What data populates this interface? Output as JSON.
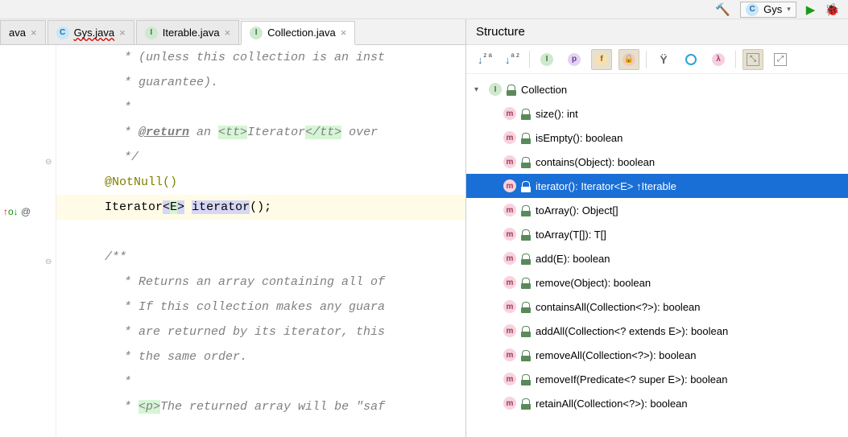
{
  "toolbar": {
    "run_config": "Gys"
  },
  "tabs": [
    {
      "label": "ava",
      "kind": "none",
      "wavy": false,
      "active": false,
      "close": true
    },
    {
      "label": "Gys.java",
      "kind": "c",
      "wavy": true,
      "active": false,
      "close": true
    },
    {
      "label": "Iterable.java",
      "kind": "i",
      "wavy": false,
      "active": false,
      "close": true
    },
    {
      "label": "Collection.java",
      "kind": "i",
      "wavy": false,
      "active": true,
      "close": true
    }
  ],
  "gutter": {
    "marker": "↑o↓ @"
  },
  "editor": {
    "lines": [
      {
        "cls": "l0",
        "parts": [
          {
            "t": " * (unless this collection is an inst",
            "c": "comment"
          }
        ]
      },
      {
        "cls": "l0",
        "parts": [
          {
            "t": " * guarantee).",
            "c": "comment"
          }
        ]
      },
      {
        "cls": "l0",
        "parts": [
          {
            "t": " *",
            "c": "comment"
          }
        ]
      },
      {
        "cls": "l0",
        "parts": [
          {
            "t": " * ",
            "c": "comment"
          },
          {
            "t": "@return",
            "c": "jdtag"
          },
          {
            "t": " an ",
            "c": "comment"
          },
          {
            "t": "<tt>",
            "c": "comment hl-green"
          },
          {
            "t": "Iterator",
            "c": "comment"
          },
          {
            "t": "</tt>",
            "c": "comment hl-green"
          },
          {
            "t": " over ",
            "c": "comment"
          }
        ]
      },
      {
        "cls": "l0",
        "parts": [
          {
            "t": " */",
            "c": "comment"
          }
        ]
      },
      {
        "cls": "",
        "parts": [
          {
            "t": "@NotNull()",
            "c": "anno"
          }
        ]
      },
      {
        "cls": "hl",
        "parts": [
          {
            "t": "Iterator",
            "c": "kw-type"
          },
          {
            "t": "<",
            "c": "caret-usages"
          },
          {
            "t": "E",
            "c": "hl-green"
          },
          {
            "t": ">",
            "c": "caret-usages"
          },
          {
            "t": " ",
            "c": ""
          },
          {
            "t": "iterator",
            "c": "caret-usages"
          },
          {
            "t": "();",
            "c": ""
          }
        ]
      },
      {
        "cls": "",
        "parts": [
          {
            "t": "",
            "c": ""
          }
        ]
      },
      {
        "cls": "",
        "parts": [
          {
            "t": "/**",
            "c": "comment"
          }
        ]
      },
      {
        "cls": "l0",
        "parts": [
          {
            "t": " * Returns an array containing all of",
            "c": "comment"
          }
        ]
      },
      {
        "cls": "l0",
        "parts": [
          {
            "t": " * If this collection makes any guara",
            "c": "comment"
          }
        ]
      },
      {
        "cls": "l0",
        "parts": [
          {
            "t": " * are returned by its iterator, this",
            "c": "comment"
          }
        ]
      },
      {
        "cls": "l0",
        "parts": [
          {
            "t": " * the same order.",
            "c": "comment"
          }
        ]
      },
      {
        "cls": "l0",
        "parts": [
          {
            "t": " *",
            "c": "comment"
          }
        ]
      },
      {
        "cls": "l0",
        "parts": [
          {
            "t": " * ",
            "c": "comment"
          },
          {
            "t": "<p>",
            "c": "comment hl-green"
          },
          {
            "t": "The returned array will be \"saf",
            "c": "comment"
          }
        ]
      }
    ]
  },
  "structure": {
    "title": "Structure",
    "root": {
      "label": "Collection"
    },
    "members": [
      {
        "label": "size(): int",
        "selected": false
      },
      {
        "label": "isEmpty(): boolean",
        "selected": false
      },
      {
        "label": "contains(Object): boolean",
        "selected": false
      },
      {
        "label": "iterator(): Iterator<E> ↑Iterable",
        "selected": true
      },
      {
        "label": "toArray(): Object[]",
        "selected": false
      },
      {
        "label": "toArray(T[]): T[]",
        "selected": false
      },
      {
        "label": "add(E): boolean",
        "selected": false
      },
      {
        "label": "remove(Object): boolean",
        "selected": false
      },
      {
        "label": "containsAll(Collection<?>): boolean",
        "selected": false
      },
      {
        "label": "addAll(Collection<? extends E>): boolean",
        "selected": false
      },
      {
        "label": "removeAll(Collection<?>): boolean",
        "selected": false
      },
      {
        "label": "removeIf(Predicate<? super E>): boolean",
        "selected": false
      },
      {
        "label": "retainAll(Collection<?>): boolean",
        "selected": false
      }
    ],
    "sort_labels": {
      "za": "z\na",
      "az": "a\nz"
    }
  }
}
